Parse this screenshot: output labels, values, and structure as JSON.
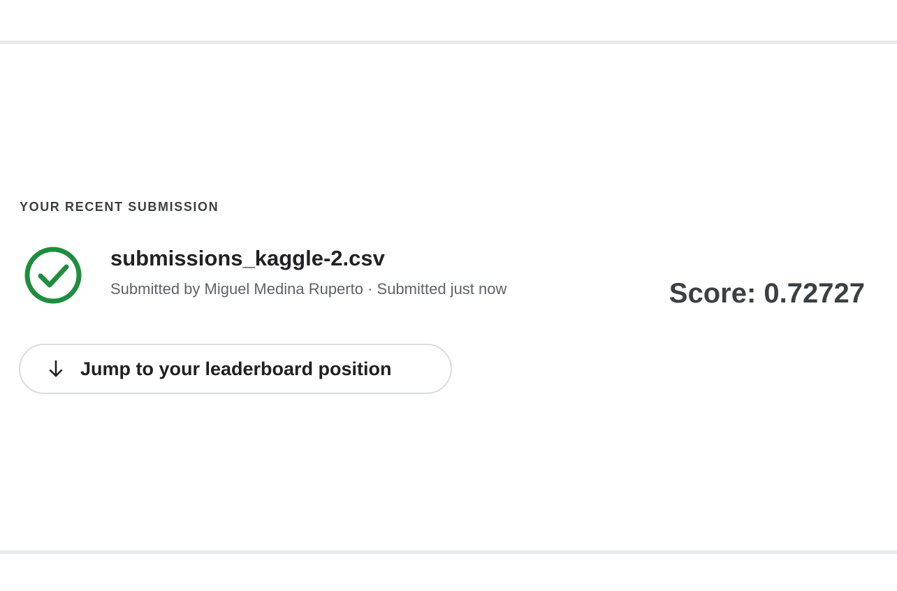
{
  "recent_submission": {
    "heading": "YOUR RECENT SUBMISSION",
    "status_icon": "check-circle-icon",
    "status_color": "#1e8e3e",
    "file_name": "submissions_kaggle-2.csv",
    "meta": "Submitted by Miguel Medina Ruperto · Submitted just now",
    "score_text": "Score: 0.72727"
  },
  "actions": {
    "jump_icon": "arrow-down-icon",
    "jump_label": "Jump to your leaderboard position"
  }
}
